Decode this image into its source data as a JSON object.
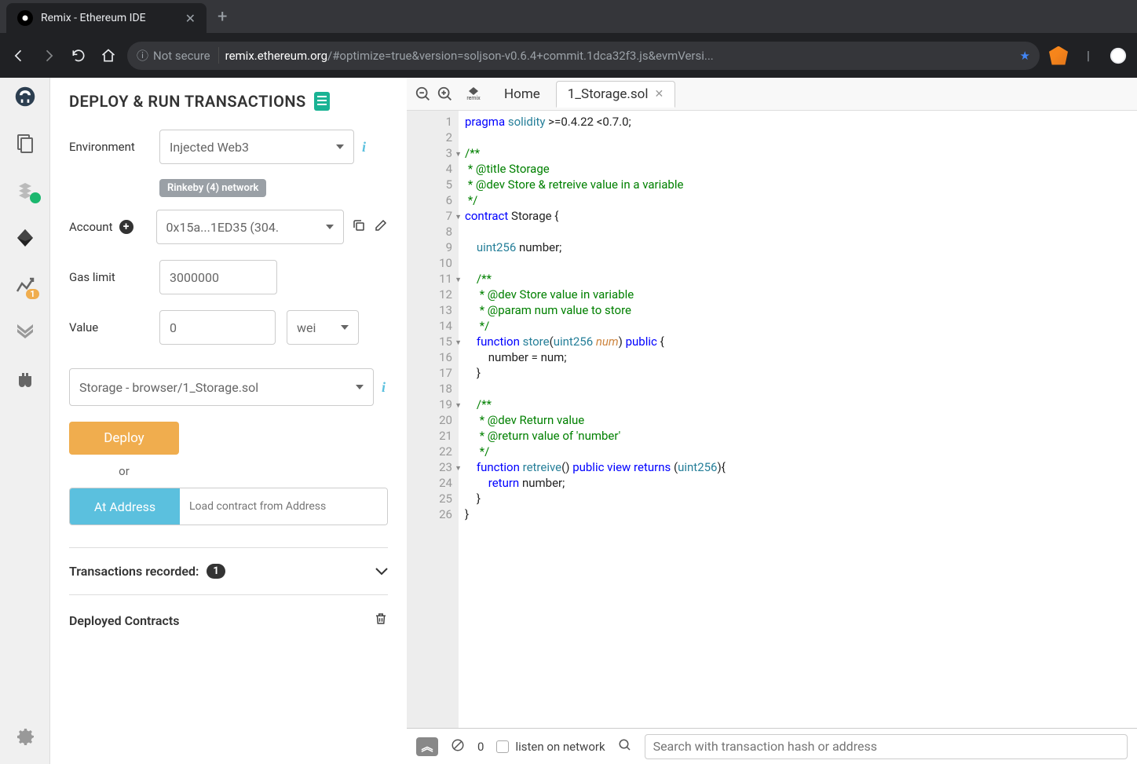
{
  "browser": {
    "tab_title": "Remix - Ethereum IDE",
    "security_label": "Not secure",
    "url_host": "remix.ethereum.org",
    "url_path": "/#optimize=true&version=soljson-v0.6.4+commit.1dca32f3.js&evmVersi..."
  },
  "panel": {
    "title": "DEPLOY & RUN TRANSACTIONS",
    "env_label": "Environment",
    "env_value": "Injected Web3",
    "network_badge": "Rinkeby (4) network",
    "acct_label": "Account",
    "acct_value": "0x15a...1ED35 (304.",
    "gas_label": "Gas limit",
    "gas_value": "3000000",
    "value_label": "Value",
    "value_amount": "0",
    "value_unit": "wei",
    "contract_value": "Storage - browser/1_Storage.sol",
    "deploy_btn": "Deploy",
    "or_label": "or",
    "at_addr_btn": "At Address",
    "addr_placeholder": "Load contract from Address",
    "tx_recorded": "Transactions recorded:",
    "tx_count": "1",
    "deployed": "Deployed Contracts"
  },
  "editor": {
    "home_tab": "Home",
    "file_tab": "1_Storage.sol",
    "code": {
      "l1a": "pragma",
      "l1b": " solidity",
      "l1c": " >=0.4.22 <0.7.0;",
      "l3": "/**",
      "l4": " * @title Storage",
      "l5": " * @dev Store & retreive value in a variable",
      "l6": " */",
      "l7a": "contract",
      "l7b": " Storage {",
      "l9a": "    uint256",
      "l9b": " number;",
      "l11": "    /**",
      "l12": "     * @dev Store value in variable",
      "l13": "     * @param num value to store",
      "l14": "     */",
      "l15a": "    function",
      "l15b": " store",
      "l15c": "(",
      "l15d": "uint256",
      "l15e": " num",
      "l15f": ") ",
      "l15g": "public",
      "l15h": " {",
      "l16": "        number = num;",
      "l17": "    }",
      "l19": "    /**",
      "l20": "     * @dev Return value ",
      "l21": "     * @return value of 'number'",
      "l22": "     */",
      "l23a": "    function",
      "l23b": " retreive",
      "l23c": "() ",
      "l23d": "public",
      "l23e": " view",
      "l23f": " returns",
      "l23g": " (",
      "l23h": "uint256",
      "l23i": "){",
      "l24a": "        return",
      "l24b": " number;",
      "l25": "    }",
      "l26": "}"
    }
  },
  "terminal": {
    "pending": "0",
    "listen_label": "listen on network",
    "search_placeholder": "Search with transaction hash or address"
  }
}
